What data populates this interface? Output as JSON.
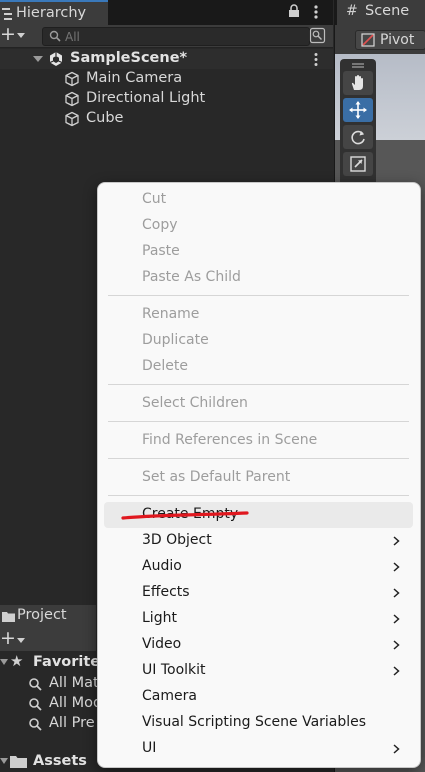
{
  "hierarchy": {
    "tab_label": "Hierarchy",
    "search_placeholder": "All",
    "scene_name": "SampleScene*",
    "objects": [
      {
        "label": "Main Camera",
        "icon": "cube-icon"
      },
      {
        "label": "Directional Light",
        "icon": "cube-icon"
      },
      {
        "label": "Cube",
        "icon": "cube-icon"
      }
    ]
  },
  "scene": {
    "tab_label": "Scene",
    "tab_icon": "#",
    "pivot_label": "Pivot",
    "tools": [
      "hand-tool-icon",
      "move-tool-icon",
      "rotate-tool-icon",
      "scale-tool-icon"
    ]
  },
  "project": {
    "tab_label": "Project",
    "favorites_label": "Favorites",
    "favorites_items": [
      "All Mat",
      "All Mod",
      "All Pre"
    ],
    "assets_label": "Assets"
  },
  "context_menu": {
    "groups": [
      [
        "Cut",
        "Copy",
        "Paste",
        "Paste As Child"
      ],
      [
        "Rename",
        "Duplicate",
        "Delete"
      ],
      [
        "Select Children"
      ],
      [
        "Find References in Scene"
      ],
      [
        "Set as Default Parent"
      ]
    ],
    "create_items": [
      {
        "label": "Create Empty",
        "submenu": false
      },
      {
        "label": "3D Object",
        "submenu": true
      },
      {
        "label": "Audio",
        "submenu": true
      },
      {
        "label": "Effects",
        "submenu": true
      },
      {
        "label": "Light",
        "submenu": true
      },
      {
        "label": "Video",
        "submenu": true
      },
      {
        "label": "UI Toolkit",
        "submenu": true
      },
      {
        "label": "Camera",
        "submenu": false
      },
      {
        "label": "Visual Scripting Scene Variables",
        "submenu": false
      },
      {
        "label": "UI",
        "submenu": true
      }
    ],
    "annotation_color": "#e0181f"
  },
  "colors": {
    "accent": "#3a79bb",
    "panel_bg": "#282828",
    "menu_bg": "#f9f9f9",
    "disabled_text": "#9d9d9d"
  }
}
